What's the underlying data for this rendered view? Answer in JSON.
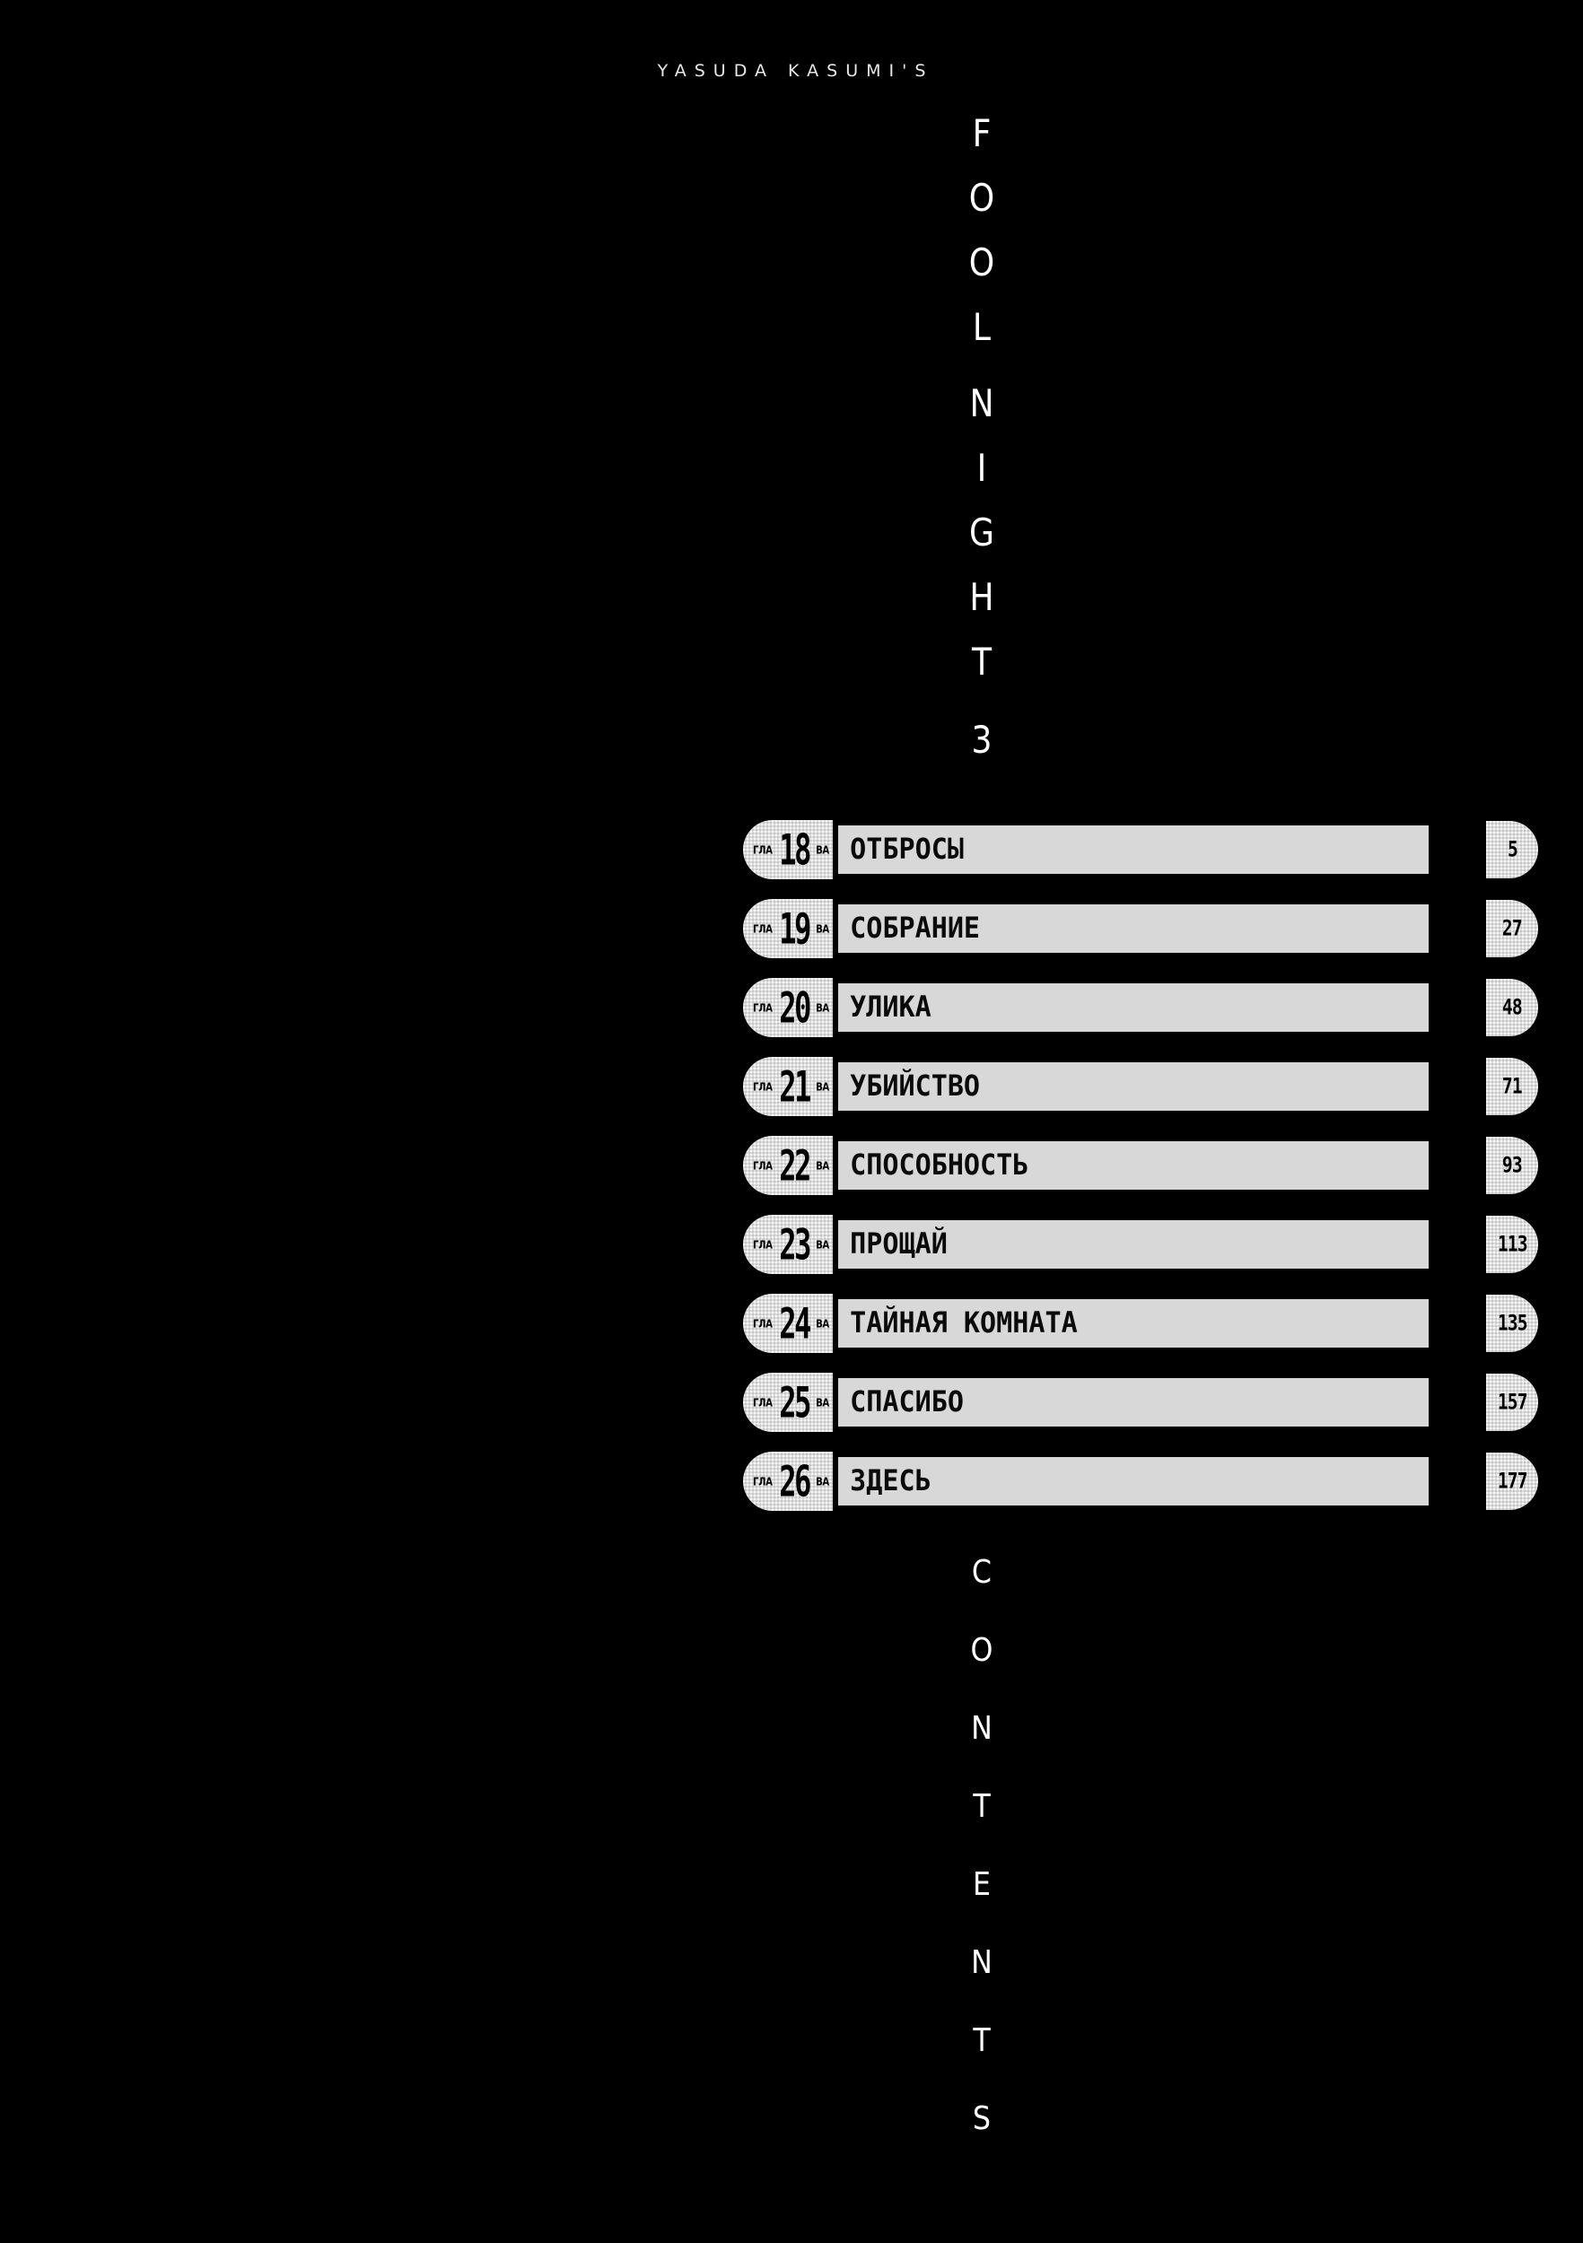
{
  "page": {
    "background_color": "#000000",
    "foreground_color": "#ffffff",
    "bar_color": "#d8d8d8"
  },
  "header": {
    "author_credit": "YASUDA KASUMI'S"
  },
  "title": {
    "full_text": "FOOL NIGHT 3",
    "letters": [
      "F",
      "O",
      "O",
      "L",
      "N",
      "I",
      "G",
      "H",
      "T",
      "3"
    ]
  },
  "contents_label": {
    "full_text": "CONTENTS",
    "letters": [
      "C",
      "O",
      "N",
      "T",
      "E",
      "N",
      "T",
      "S"
    ]
  },
  "chapter_list": {
    "badge_prefix": "ГЛА",
    "badge_suffix": "ВА",
    "rows": [
      {
        "number": "18",
        "title": "ОТБРОСЫ",
        "page": "5"
      },
      {
        "number": "19",
        "title": "СОБРАНИЕ",
        "page": "27"
      },
      {
        "number": "20",
        "title": "УЛИКА",
        "page": "48"
      },
      {
        "number": "21",
        "title": "УБИЙСТВО",
        "page": "71"
      },
      {
        "number": "22",
        "title": "СПОСОБНОСТЬ",
        "page": "93"
      },
      {
        "number": "23",
        "title": "ПРОЩАЙ",
        "page": "113"
      },
      {
        "number": "24",
        "title": "ТАЙНАЯ КОМНАТА",
        "page": "135"
      },
      {
        "number": "25",
        "title": "СПАСИБО",
        "page": "157"
      },
      {
        "number": "26",
        "title": "ЗДЕСЬ",
        "page": "177"
      }
    ]
  }
}
